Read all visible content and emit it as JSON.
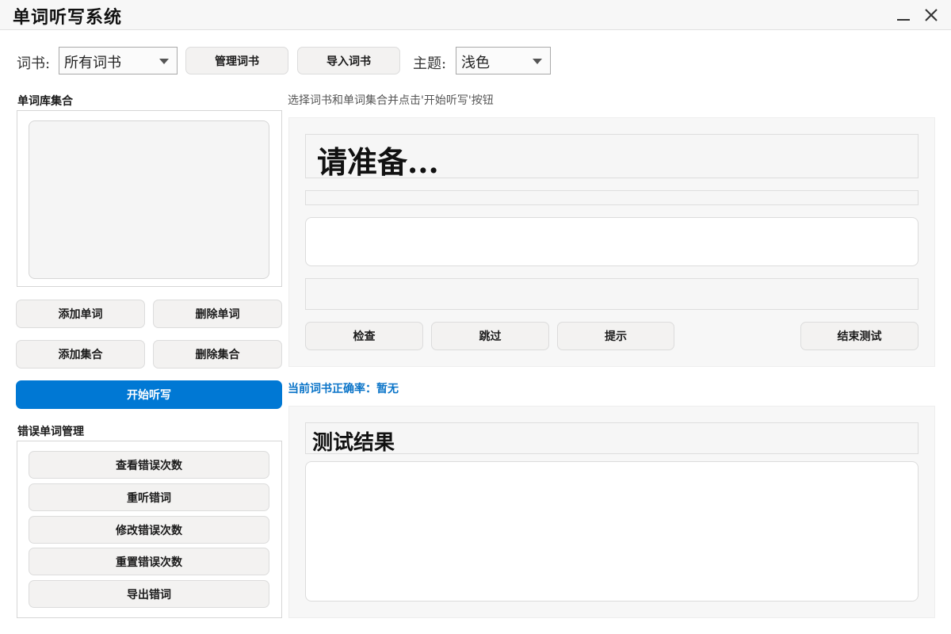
{
  "window": {
    "title": "单词听写系统",
    "minimize_icon": "minimize-icon",
    "close_icon": "close-icon"
  },
  "toolbar": {
    "book_label": "词书:",
    "book_value": "所有词书",
    "manage_books": "管理词书",
    "import_books": "导入词书",
    "theme_label": "主题:",
    "theme_value": "浅色"
  },
  "sidebar": {
    "word_sets_title": "单词库集合",
    "add_word": "添加单词",
    "delete_word": "删除单词",
    "add_set": "添加集合",
    "delete_set": "删除集合",
    "start": "开始听写",
    "mistakes_title": "错误单词管理",
    "mistake_actions": [
      "查看错误次数",
      "重听错词",
      "修改错误次数",
      "重置错误次数",
      "导出错词"
    ]
  },
  "main": {
    "hint": "选择词书和单词集合并点击'开始听写'按钮",
    "word_display": "请准备...",
    "check": "检查",
    "skip": "跳过",
    "hint_button": "提示",
    "end_test": "结束测试",
    "accuracy": "当前词书正确率：暂无",
    "result_title": "测试结果"
  },
  "colors": {
    "accent": "#0078d4",
    "accuracy_text": "#0a74c8"
  }
}
